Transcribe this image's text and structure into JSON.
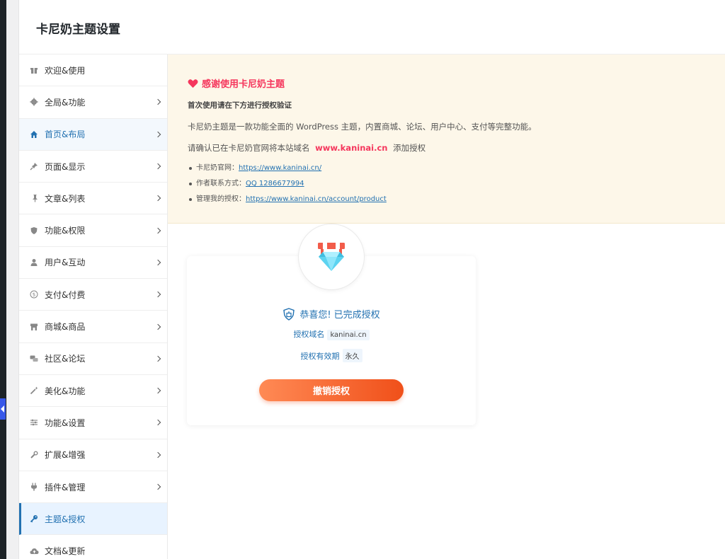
{
  "header": {
    "title": "卡尼奶主题设置"
  },
  "sidebar": {
    "items": [
      {
        "label": "欢迎&使用",
        "icon": "gift-icon"
      },
      {
        "label": "全局&功能",
        "icon": "gear-icon"
      },
      {
        "label": "首页&布局",
        "icon": "home-icon"
      },
      {
        "label": "页面&显示",
        "icon": "pin-icon"
      },
      {
        "label": "文章&列表",
        "icon": "thumbtack-icon"
      },
      {
        "label": "功能&权限",
        "icon": "shield-icon"
      },
      {
        "label": "用户&互动",
        "icon": "user-icon"
      },
      {
        "label": "支付&付费",
        "icon": "dollar-icon"
      },
      {
        "label": "商城&商品",
        "icon": "store-icon"
      },
      {
        "label": "社区&论坛",
        "icon": "community-icon"
      },
      {
        "label": "美化&功能",
        "icon": "magic-wand-icon"
      },
      {
        "label": "功能&设置",
        "icon": "sliders-icon"
      },
      {
        "label": "扩展&增强",
        "icon": "wrench-icon"
      },
      {
        "label": "插件&管理",
        "icon": "plug-icon"
      },
      {
        "label": "主题&授权",
        "icon": "key-icon"
      },
      {
        "label": "文档&更新",
        "icon": "cloud-upload-icon"
      }
    ]
  },
  "notice": {
    "title": "感谢使用卡尼奶主题",
    "first_use": "首次使用请在下方进行授权验证",
    "desc": "卡尼奶主题是一款功能全面的 WordPress 主题，内置商城、论坛、用户中心、支付等完整功能。",
    "confirm_prefix": "请确认已在卡尼奶官网将本站域名",
    "confirm_domain": "www.kaninai.cn",
    "confirm_suffix": "添加授权",
    "links": [
      {
        "label": "卡尼奶官网：",
        "text": "https://www.kaninai.cn/"
      },
      {
        "label": "作者联系方式：",
        "text": "QQ 1286677994"
      },
      {
        "label": "管理我的授权：",
        "text": "https://www.kaninai.cn/account/product"
      }
    ]
  },
  "license": {
    "success": "恭喜您! 已完成授权",
    "domain_label": "授权域名",
    "domain_value": "kaninai.cn",
    "validity_label": "授权有效期",
    "validity_value": "永久",
    "revoke_label": "撤销授权"
  },
  "colors": {
    "accent": "#2271b1",
    "highlight": "#f5365c",
    "notice_bg": "#fdf7e9",
    "button_start": "#ff8a55",
    "button_end": "#f0501a"
  }
}
